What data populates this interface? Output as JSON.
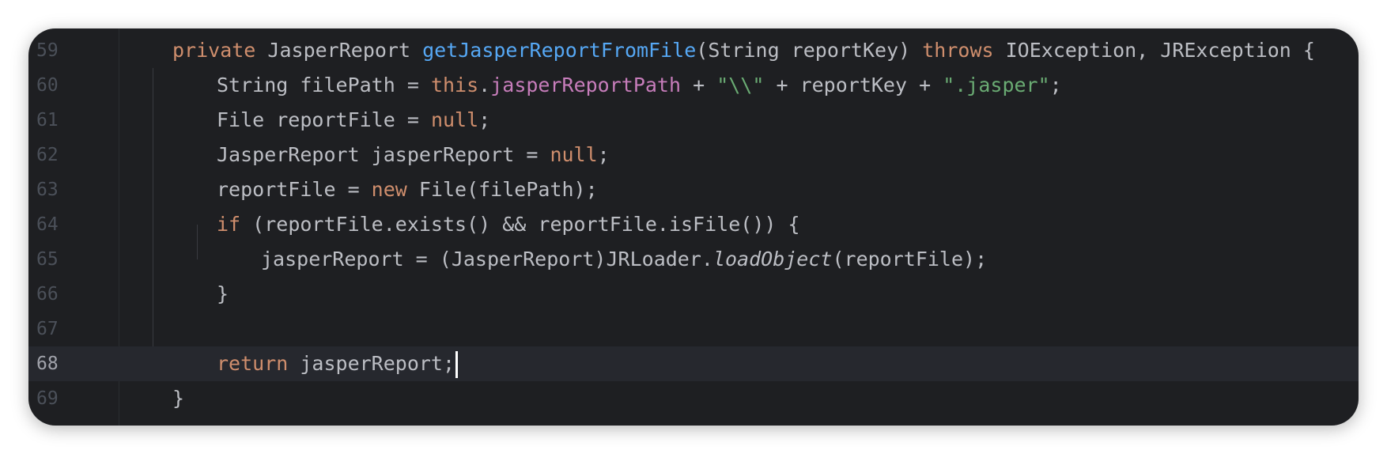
{
  "editor": {
    "current_line": "68",
    "lines": [
      {
        "number": "59",
        "indent": 0,
        "tokens": [
          {
            "t": "private",
            "k": "kw"
          },
          {
            "t": " JasperReport "
          },
          {
            "t": "getJasperReportFromFile",
            "k": "fn"
          },
          {
            "t": "(String reportKey) "
          },
          {
            "t": "throws",
            "k": "kw"
          },
          {
            "t": " IOException, JRException {"
          }
        ]
      },
      {
        "number": "60",
        "indent": 1,
        "tokens": [
          {
            "t": "String filePath = "
          },
          {
            "t": "this",
            "k": "kw"
          },
          {
            "t": "."
          },
          {
            "t": "jasperReportPath",
            "k": "field"
          },
          {
            "t": " + "
          },
          {
            "t": "\"\\\\\"",
            "k": "str"
          },
          {
            "t": " + reportKey + "
          },
          {
            "t": "\".jasper\"",
            "k": "str"
          },
          {
            "t": ";"
          }
        ]
      },
      {
        "number": "61",
        "indent": 1,
        "tokens": [
          {
            "t": "File reportFile = "
          },
          {
            "t": "null",
            "k": "kw"
          },
          {
            "t": ";"
          }
        ]
      },
      {
        "number": "62",
        "indent": 1,
        "tokens": [
          {
            "t": "JasperReport jasperReport = "
          },
          {
            "t": "null",
            "k": "kw"
          },
          {
            "t": ";"
          }
        ]
      },
      {
        "number": "63",
        "indent": 1,
        "tokens": [
          {
            "t": "reportFile = "
          },
          {
            "t": "new",
            "k": "kw"
          },
          {
            "t": " File(filePath);"
          }
        ]
      },
      {
        "number": "64",
        "indent": 1,
        "tokens": [
          {
            "t": "if",
            "k": "kw"
          },
          {
            "t": " (reportFile.exists() && reportFile.isFile()) {"
          }
        ]
      },
      {
        "number": "65",
        "indent": 2,
        "tokens": [
          {
            "t": "jasperReport = (JasperReport)JRLoader."
          },
          {
            "t": "loadObject",
            "k": "static"
          },
          {
            "t": "(reportFile);"
          }
        ]
      },
      {
        "number": "66",
        "indent": 1,
        "tokens": [
          {
            "t": "}"
          }
        ]
      },
      {
        "number": "67",
        "indent": 0,
        "tokens": []
      },
      {
        "number": "68",
        "indent": 1,
        "tokens": [
          {
            "t": "return",
            "k": "kw"
          },
          {
            "t": " jasperReport;"
          }
        ],
        "caret": true
      },
      {
        "number": "69",
        "indent": 0,
        "tokens": [
          {
            "t": "}"
          }
        ]
      }
    ]
  }
}
